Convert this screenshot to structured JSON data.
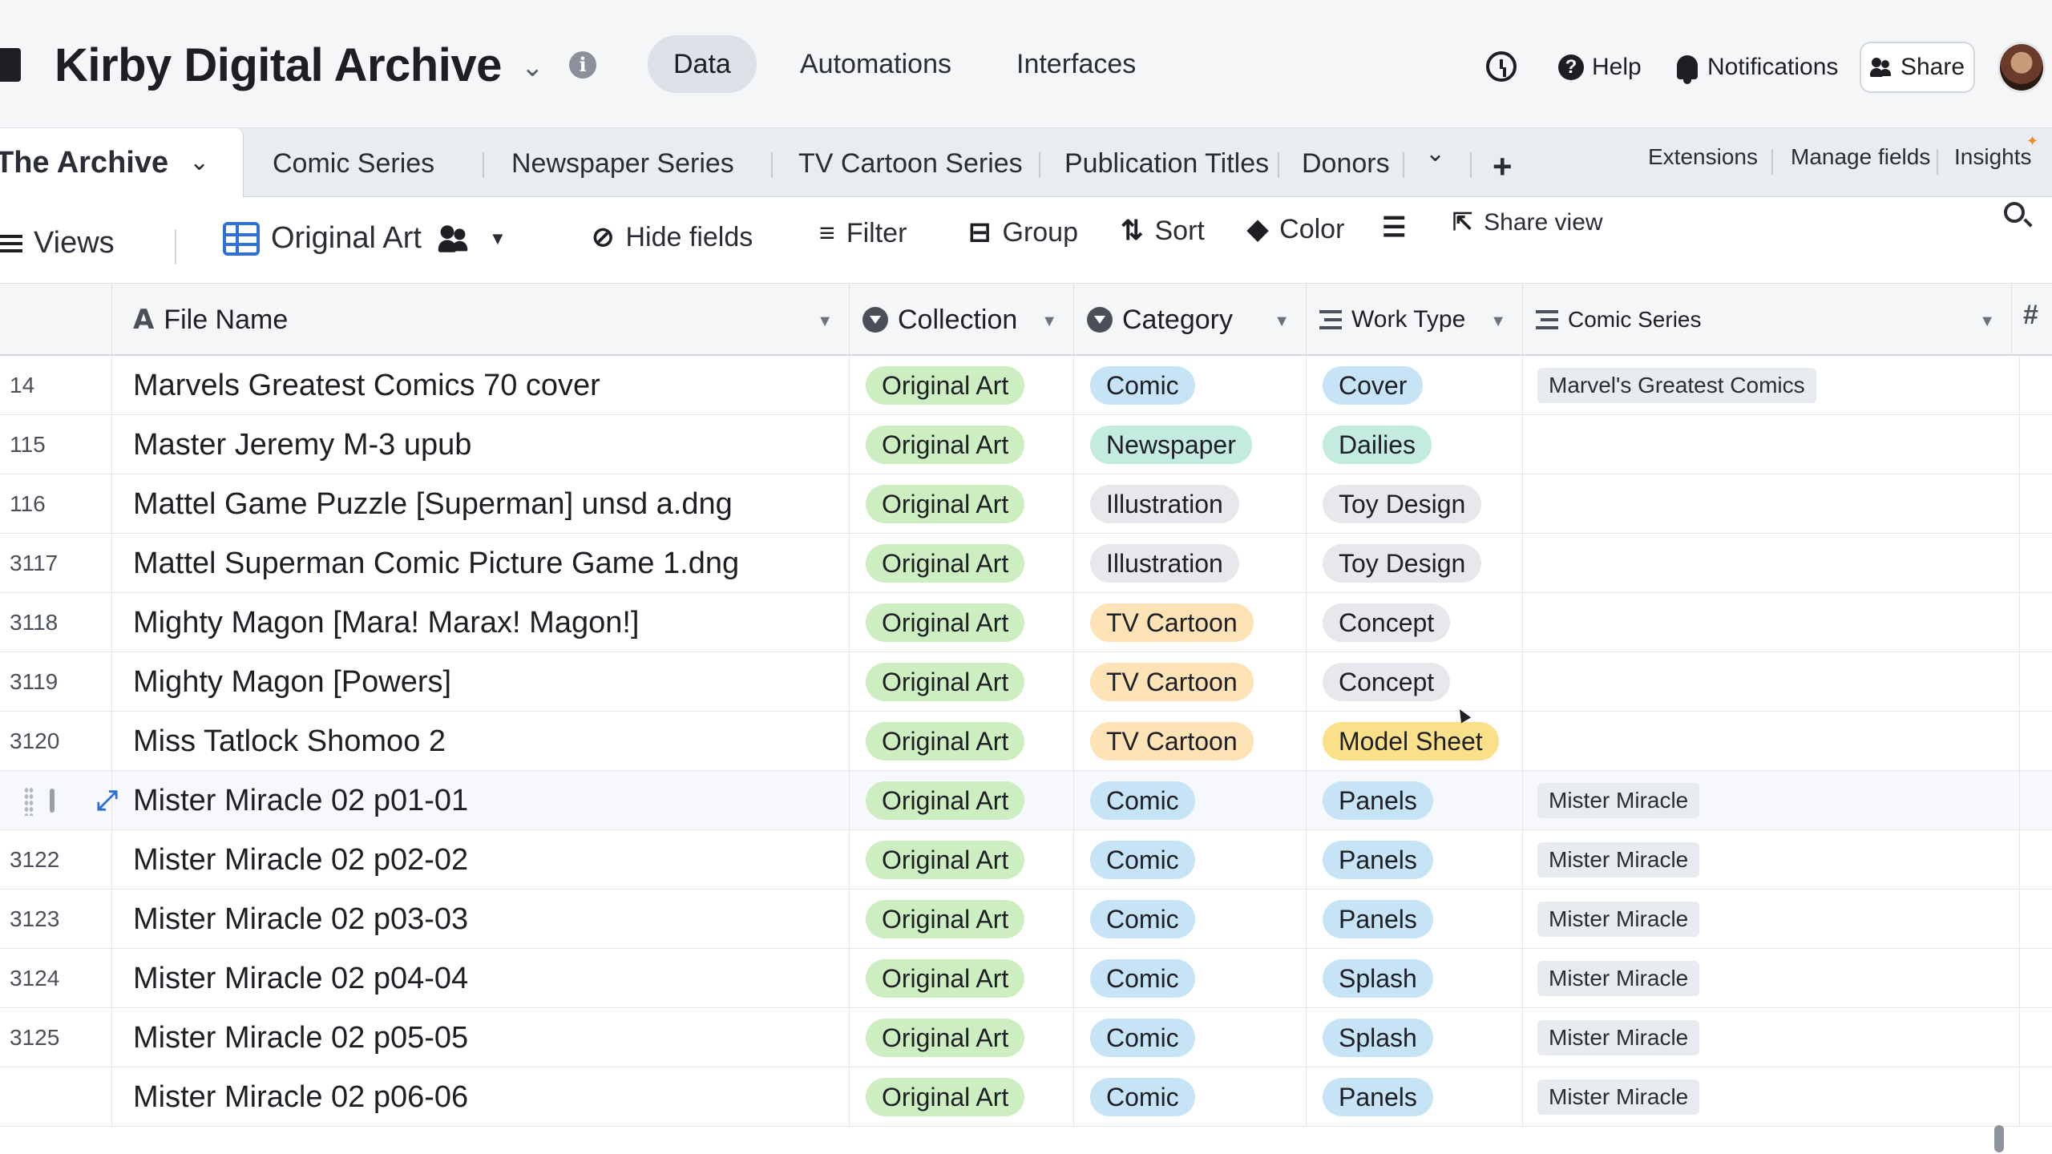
{
  "app": {
    "base_title": "Kirby Digital Archive",
    "nav_tabs": [
      "Data",
      "Automations",
      "Interfaces"
    ],
    "active_nav": "Data",
    "help_label": "Help",
    "notifications_label": "Notifications",
    "share_label": "Share"
  },
  "tables": {
    "active": "The Archive",
    "tabs": [
      "Comic Series",
      "Newspaper Series",
      "TV Cartoon Series",
      "Publication Titles",
      "Donors"
    ],
    "right_links": [
      "Extensions",
      "Manage fields",
      "Insights"
    ]
  },
  "viewbar": {
    "views_label": "Views",
    "view_name": "Original Art",
    "hide_fields": "Hide fields",
    "filter": "Filter",
    "group": "Group",
    "sort": "Sort",
    "color": "Color",
    "share_view": "Share view"
  },
  "columns": {
    "file_name": "File Name",
    "collection": "Collection",
    "category": "Category",
    "work_type": "Work Type",
    "comic_series": "Comic Series"
  },
  "rows": [
    {
      "num": "14",
      "name": "Marvels Greatest Comics 70 cover",
      "collection": "Original Art",
      "category": "Comic",
      "work": "Cover",
      "series": "Marvel's Greatest Comics"
    },
    {
      "num": "115",
      "name": "Master Jeremy M-3 upub",
      "collection": "Original Art",
      "category": "Newspaper",
      "work": "Dailies",
      "series": ""
    },
    {
      "num": "116",
      "name": "Mattel Game Puzzle [Superman] unsd a.dng",
      "collection": "Original Art",
      "category": "Illustration",
      "work": "Toy Design",
      "series": ""
    },
    {
      "num": "3117",
      "name": "Mattel Superman Comic Picture Game 1.dng",
      "collection": "Original Art",
      "category": "Illustration",
      "work": "Toy Design",
      "series": ""
    },
    {
      "num": "3118",
      "name": "Mighty Magon [Mara! Marax! Magon!]",
      "collection": "Original Art",
      "category": "TV Cartoon",
      "work": "Concept",
      "series": ""
    },
    {
      "num": "3119",
      "name": "Mighty Magon [Powers]",
      "collection": "Original Art",
      "category": "TV Cartoon",
      "work": "Concept",
      "series": ""
    },
    {
      "num": "3120",
      "name": "Miss Tatlock Shomoo 2",
      "collection": "Original Art",
      "category": "TV Cartoon",
      "work": "Model Sheet",
      "series": ""
    },
    {
      "num": "",
      "name": "Mister Miracle 02 p01-01",
      "collection": "Original Art",
      "category": "Comic",
      "work": "Panels",
      "series": "Mister Miracle"
    },
    {
      "num": "3122",
      "name": "Mister Miracle 02 p02-02",
      "collection": "Original Art",
      "category": "Comic",
      "work": "Panels",
      "series": "Mister Miracle"
    },
    {
      "num": "3123",
      "name": "Mister Miracle 02 p03-03",
      "collection": "Original Art",
      "category": "Comic",
      "work": "Panels",
      "series": "Mister Miracle"
    },
    {
      "num": "3124",
      "name": "Mister Miracle 02 p04-04",
      "collection": "Original Art",
      "category": "Comic",
      "work": "Splash",
      "series": "Mister Miracle"
    },
    {
      "num": "3125",
      "name": "Mister Miracle 02 p05-05",
      "collection": "Original Art",
      "category": "Comic",
      "work": "Splash",
      "series": "Mister Miracle"
    },
    {
      "num": "",
      "name": "Mister Miracle 02 p06-06",
      "collection": "Original Art",
      "category": "Comic",
      "work": "Panels",
      "series": "Mister Miracle"
    }
  ],
  "colors": {
    "Original Art": "p-green",
    "Comic": "p-blue",
    "Newspaper": "p-teal",
    "Illustration": "p-gray",
    "TV Cartoon": "p-orange",
    "Cover": "p-blue",
    "Dailies": "p-teal",
    "Toy Design": "p-gray",
    "Concept": "p-gray",
    "Model Sheet": "p-yellow",
    "Panels": "p-blue",
    "Splash": "p-blue"
  }
}
